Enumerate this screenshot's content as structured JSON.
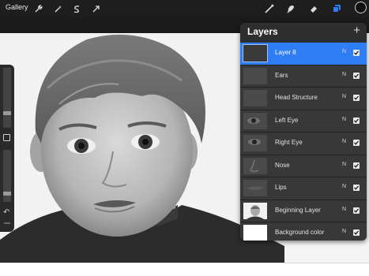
{
  "toolbar": {
    "gallery_label": "Gallery",
    "left_tools": [
      "wrench-icon",
      "magic-wand-icon",
      "selection-icon",
      "transform-arrow-icon"
    ],
    "right_tools": [
      "brush-icon",
      "smudge-icon",
      "eraser-icon",
      "layers-icon"
    ],
    "layers_icon_color": "#2f7df5",
    "current_color": "#111111"
  },
  "sidebar": {
    "brush_size_level": 0.73,
    "opacity_level": 0.48
  },
  "layers_panel": {
    "title": "Layers",
    "add_label": "+",
    "selected_color": "#2f7df5",
    "layers": [
      {
        "name": "Layer 8",
        "blend": "N",
        "visible": true,
        "selected": true
      },
      {
        "name": "Ears",
        "blend": "N",
        "visible": true,
        "selected": false
      },
      {
        "name": "Head Structure",
        "blend": "N",
        "visible": true,
        "selected": false
      },
      {
        "name": "Left Eye",
        "blend": "N",
        "visible": true,
        "selected": false
      },
      {
        "name": "Right Eye",
        "blend": "N",
        "visible": true,
        "selected": false
      },
      {
        "name": "Nose",
        "blend": "N",
        "visible": true,
        "selected": false
      },
      {
        "name": "Lips",
        "blend": "N",
        "visible": true,
        "selected": false
      },
      {
        "name": "Beginning Layer",
        "blend": "N",
        "visible": true,
        "selected": false
      },
      {
        "name": "Background color",
        "blend": "N",
        "visible": true,
        "selected": false
      }
    ]
  }
}
